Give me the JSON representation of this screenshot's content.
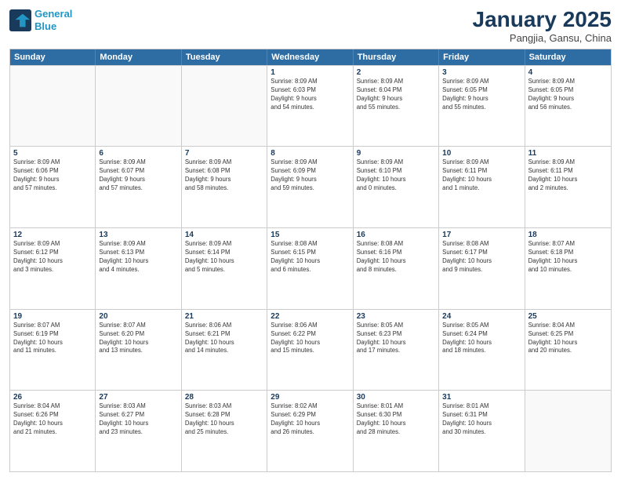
{
  "header": {
    "logo_line1": "General",
    "logo_line2": "Blue",
    "month": "January 2025",
    "location": "Pangjia, Gansu, China"
  },
  "weekdays": [
    "Sunday",
    "Monday",
    "Tuesday",
    "Wednesday",
    "Thursday",
    "Friday",
    "Saturday"
  ],
  "weeks": [
    [
      {
        "day": "",
        "info": ""
      },
      {
        "day": "",
        "info": ""
      },
      {
        "day": "",
        "info": ""
      },
      {
        "day": "1",
        "info": "Sunrise: 8:09 AM\nSunset: 6:03 PM\nDaylight: 9 hours\nand 54 minutes."
      },
      {
        "day": "2",
        "info": "Sunrise: 8:09 AM\nSunset: 6:04 PM\nDaylight: 9 hours\nand 55 minutes."
      },
      {
        "day": "3",
        "info": "Sunrise: 8:09 AM\nSunset: 6:05 PM\nDaylight: 9 hours\nand 55 minutes."
      },
      {
        "day": "4",
        "info": "Sunrise: 8:09 AM\nSunset: 6:05 PM\nDaylight: 9 hours\nand 56 minutes."
      }
    ],
    [
      {
        "day": "5",
        "info": "Sunrise: 8:09 AM\nSunset: 6:06 PM\nDaylight: 9 hours\nand 57 minutes."
      },
      {
        "day": "6",
        "info": "Sunrise: 8:09 AM\nSunset: 6:07 PM\nDaylight: 9 hours\nand 57 minutes."
      },
      {
        "day": "7",
        "info": "Sunrise: 8:09 AM\nSunset: 6:08 PM\nDaylight: 9 hours\nand 58 minutes."
      },
      {
        "day": "8",
        "info": "Sunrise: 8:09 AM\nSunset: 6:09 PM\nDaylight: 9 hours\nand 59 minutes."
      },
      {
        "day": "9",
        "info": "Sunrise: 8:09 AM\nSunset: 6:10 PM\nDaylight: 10 hours\nand 0 minutes."
      },
      {
        "day": "10",
        "info": "Sunrise: 8:09 AM\nSunset: 6:11 PM\nDaylight: 10 hours\nand 1 minute."
      },
      {
        "day": "11",
        "info": "Sunrise: 8:09 AM\nSunset: 6:11 PM\nDaylight: 10 hours\nand 2 minutes."
      }
    ],
    [
      {
        "day": "12",
        "info": "Sunrise: 8:09 AM\nSunset: 6:12 PM\nDaylight: 10 hours\nand 3 minutes."
      },
      {
        "day": "13",
        "info": "Sunrise: 8:09 AM\nSunset: 6:13 PM\nDaylight: 10 hours\nand 4 minutes."
      },
      {
        "day": "14",
        "info": "Sunrise: 8:09 AM\nSunset: 6:14 PM\nDaylight: 10 hours\nand 5 minutes."
      },
      {
        "day": "15",
        "info": "Sunrise: 8:08 AM\nSunset: 6:15 PM\nDaylight: 10 hours\nand 6 minutes."
      },
      {
        "day": "16",
        "info": "Sunrise: 8:08 AM\nSunset: 6:16 PM\nDaylight: 10 hours\nand 8 minutes."
      },
      {
        "day": "17",
        "info": "Sunrise: 8:08 AM\nSunset: 6:17 PM\nDaylight: 10 hours\nand 9 minutes."
      },
      {
        "day": "18",
        "info": "Sunrise: 8:07 AM\nSunset: 6:18 PM\nDaylight: 10 hours\nand 10 minutes."
      }
    ],
    [
      {
        "day": "19",
        "info": "Sunrise: 8:07 AM\nSunset: 6:19 PM\nDaylight: 10 hours\nand 11 minutes."
      },
      {
        "day": "20",
        "info": "Sunrise: 8:07 AM\nSunset: 6:20 PM\nDaylight: 10 hours\nand 13 minutes."
      },
      {
        "day": "21",
        "info": "Sunrise: 8:06 AM\nSunset: 6:21 PM\nDaylight: 10 hours\nand 14 minutes."
      },
      {
        "day": "22",
        "info": "Sunrise: 8:06 AM\nSunset: 6:22 PM\nDaylight: 10 hours\nand 15 minutes."
      },
      {
        "day": "23",
        "info": "Sunrise: 8:05 AM\nSunset: 6:23 PM\nDaylight: 10 hours\nand 17 minutes."
      },
      {
        "day": "24",
        "info": "Sunrise: 8:05 AM\nSunset: 6:24 PM\nDaylight: 10 hours\nand 18 minutes."
      },
      {
        "day": "25",
        "info": "Sunrise: 8:04 AM\nSunset: 6:25 PM\nDaylight: 10 hours\nand 20 minutes."
      }
    ],
    [
      {
        "day": "26",
        "info": "Sunrise: 8:04 AM\nSunset: 6:26 PM\nDaylight: 10 hours\nand 21 minutes."
      },
      {
        "day": "27",
        "info": "Sunrise: 8:03 AM\nSunset: 6:27 PM\nDaylight: 10 hours\nand 23 minutes."
      },
      {
        "day": "28",
        "info": "Sunrise: 8:03 AM\nSunset: 6:28 PM\nDaylight: 10 hours\nand 25 minutes."
      },
      {
        "day": "29",
        "info": "Sunrise: 8:02 AM\nSunset: 6:29 PM\nDaylight: 10 hours\nand 26 minutes."
      },
      {
        "day": "30",
        "info": "Sunrise: 8:01 AM\nSunset: 6:30 PM\nDaylight: 10 hours\nand 28 minutes."
      },
      {
        "day": "31",
        "info": "Sunrise: 8:01 AM\nSunset: 6:31 PM\nDaylight: 10 hours\nand 30 minutes."
      },
      {
        "day": "",
        "info": ""
      }
    ]
  ]
}
